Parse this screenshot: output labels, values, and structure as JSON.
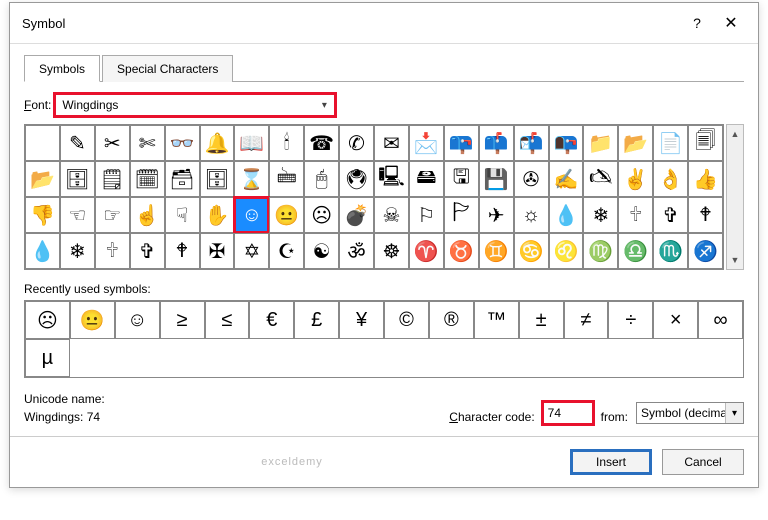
{
  "dialog": {
    "title": "Symbol"
  },
  "tabs": {
    "symbols": "Symbols",
    "special": "Special Characters"
  },
  "font": {
    "label_prefix": "F",
    "label_rest": "ont:",
    "value": "Wingdings"
  },
  "grid": {
    "rows": [
      [
        " ",
        "✎",
        "✂",
        "✄",
        "👓",
        "🔔",
        "📖",
        "🕯",
        "☎",
        "✆",
        "✉",
        "📩",
        "📪",
        "📫",
        "📬",
        "📭",
        "📁",
        "📂",
        "📄",
        "🗐"
      ],
      [
        "📂",
        "🗄",
        "🗒",
        "🗓",
        "🗃",
        "🗄",
        "⌛",
        "🖮",
        "🖱",
        "🖲",
        "🖳",
        "🖴",
        "🖫",
        "💾",
        "✇",
        "✍",
        "🖎",
        "✌",
        "👌",
        "👍"
      ],
      [
        "👎",
        "☜",
        "☞",
        "☝",
        "☟",
        "✋",
        "☺",
        "😐",
        "☹",
        "💣",
        "☠",
        "⚐",
        "🏱",
        "✈",
        "☼",
        "💧",
        "❄",
        "🕆",
        "✞",
        "🕈"
      ],
      [
        "💧",
        "❄",
        "🕆",
        "✞",
        "🕈",
        "✠",
        "✡",
        "☪",
        "☯",
        "ॐ",
        "☸",
        "♈",
        "♉",
        "♊",
        "♋",
        "♌",
        "♍",
        "♎",
        "♏",
        "♐"
      ]
    ],
    "selected": {
      "row": 2,
      "col": 6
    }
  },
  "recent": {
    "label_prefix": "R",
    "label_rest": "ecently used symbols:",
    "items": [
      "☹",
      "😐",
      "☺",
      "≥",
      "≤",
      "€",
      "£",
      "¥",
      "©",
      "®",
      "™",
      "±",
      "≠",
      "÷",
      "×",
      "∞",
      "µ"
    ]
  },
  "unicode": {
    "label": "Unicode name:",
    "value": "Wingdings: 74"
  },
  "charcode": {
    "label_prefix": "C",
    "label_rest": "haracter code:",
    "value": "74"
  },
  "from": {
    "label": "from:",
    "value": "Symbol (decimal)"
  },
  "buttons": {
    "insert": "Insert",
    "cancel": "Cancel"
  },
  "watermark": "exceldemy"
}
